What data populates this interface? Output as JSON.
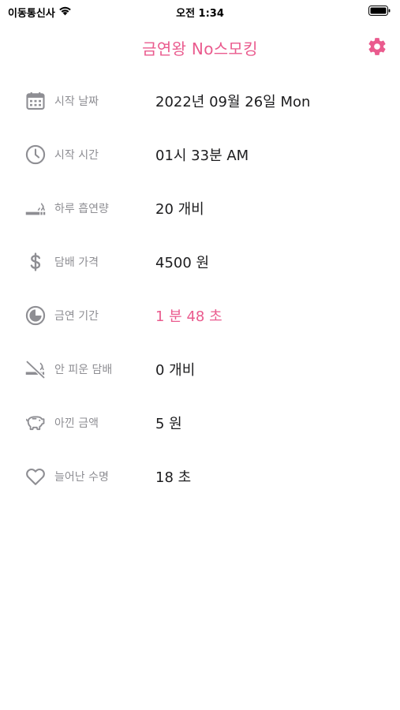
{
  "status_bar": {
    "carrier": "이동통신사",
    "time": "오전 1:34"
  },
  "nav": {
    "title": "금연왕 No스모킹",
    "settings_icon": "gear-icon"
  },
  "colors": {
    "accent": "#ea5b8e",
    "label": "#8e8e93",
    "icon": "#8e8e93",
    "value": "#1c1c1e"
  },
  "rows": [
    {
      "icon": "calendar-icon",
      "label": "시작 날짜",
      "value": "2022년 09월 26일 Mon"
    },
    {
      "icon": "clock-icon",
      "label": "시작 시간",
      "value": "01시 33분 AM"
    },
    {
      "icon": "smoking-icon",
      "label": "하루 흡연량",
      "value": "20 개비"
    },
    {
      "icon": "dollar-icon",
      "label": "담배 가격",
      "value": "4500 원"
    },
    {
      "icon": "timer-pie-icon",
      "label": "금연 기간",
      "value": "1 분 48 초"
    },
    {
      "icon": "no-smoking-icon",
      "label": "안 피운 담배",
      "value": "0 개비"
    },
    {
      "icon": "piggy-bank-icon",
      "label": "아낀 금액",
      "value": "5 원"
    },
    {
      "icon": "heart-icon",
      "label": "늘어난 수명",
      "value": "18 초"
    }
  ]
}
